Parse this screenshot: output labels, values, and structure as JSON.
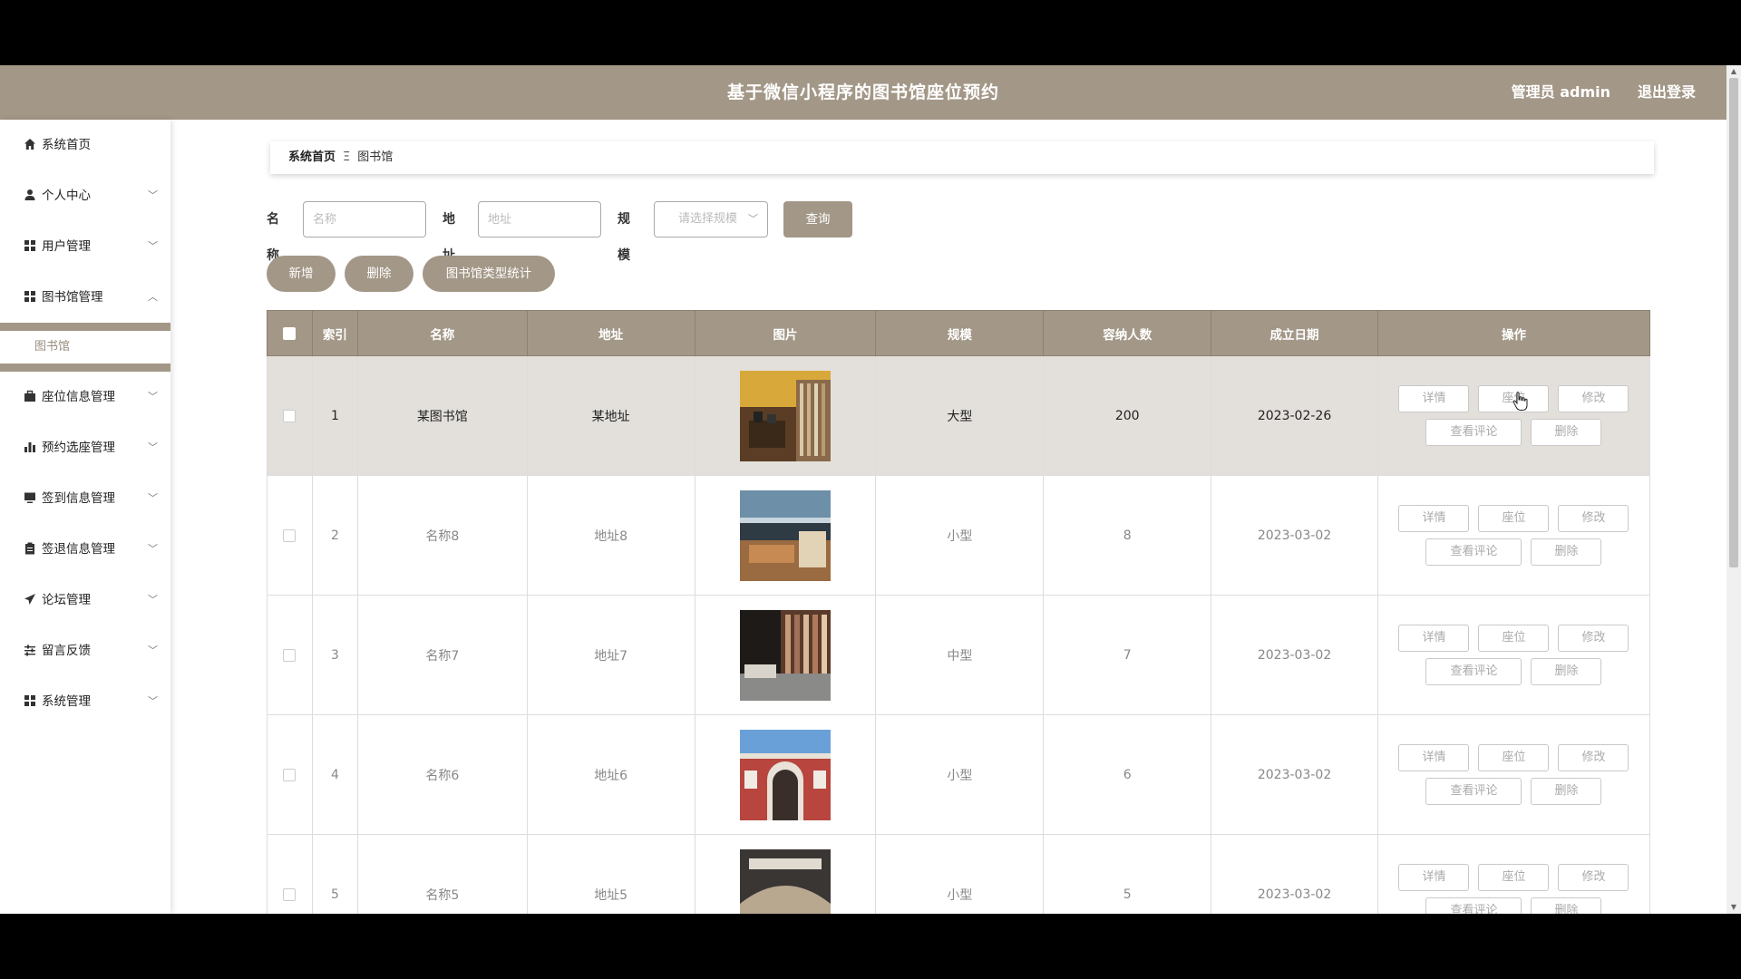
{
  "header": {
    "title": "基于微信小程序的图书馆座位预约",
    "user": "管理员 admin",
    "logout": "退出登录"
  },
  "sidebar": {
    "items": [
      {
        "label": "系统首页",
        "icon": "home-icon"
      },
      {
        "label": "个人中心",
        "icon": "user-icon"
      },
      {
        "label": "用户管理",
        "icon": "grid-icon"
      },
      {
        "label": "图书馆管理",
        "icon": "grid-icon",
        "expanded": true
      },
      {
        "label": "座位信息管理",
        "icon": "briefcase-icon"
      },
      {
        "label": "预约选座管理",
        "icon": "bar-chart-icon"
      },
      {
        "label": "签到信息管理",
        "icon": "monitor-icon"
      },
      {
        "label": "签退信息管理",
        "icon": "clipboard-icon"
      },
      {
        "label": "论坛管理",
        "icon": "send-icon"
      },
      {
        "label": "留言反馈",
        "icon": "sliders-icon"
      },
      {
        "label": "系统管理",
        "icon": "grid-icon"
      }
    ],
    "submenu_label": "图书馆"
  },
  "breadcrumb": {
    "home": "系统首页",
    "separator": "Ξ",
    "current": "图书馆"
  },
  "search": {
    "name_label": "名称",
    "name_placeholder": "名称",
    "address_label": "地址",
    "address_placeholder": "地址",
    "scale_label": "规模",
    "scale_placeholder": "请选择规模",
    "query_button": "查询"
  },
  "actions": {
    "add": "新增",
    "delete": "删除",
    "stats": "图书馆类型统计"
  },
  "table": {
    "headers": [
      "索引",
      "名称",
      "地址",
      "图片",
      "规模",
      "容纳人数",
      "成立日期",
      "操作"
    ],
    "rows": [
      {
        "index": "1",
        "name": "某图书馆",
        "address": "某地址",
        "scale": "大型",
        "capacity": "200",
        "date": "2023-02-26"
      },
      {
        "index": "2",
        "name": "名称8",
        "address": "地址8",
        "scale": "小型",
        "capacity": "8",
        "date": "2023-03-02"
      },
      {
        "index": "3",
        "name": "名称7",
        "address": "地址7",
        "scale": "中型",
        "capacity": "7",
        "date": "2023-03-02"
      },
      {
        "index": "4",
        "name": "名称6",
        "address": "地址6",
        "scale": "小型",
        "capacity": "6",
        "date": "2023-03-02"
      },
      {
        "index": "5",
        "name": "名称5",
        "address": "地址5",
        "scale": "小型",
        "capacity": "5",
        "date": "2023-03-02"
      }
    ],
    "ops": {
      "detail": "详情",
      "seat": "座位",
      "edit": "修改",
      "comments": "查看评论",
      "delete": "删除"
    }
  },
  "colors": {
    "primary": "#a39787",
    "selected_row": "#e3e0dc"
  }
}
